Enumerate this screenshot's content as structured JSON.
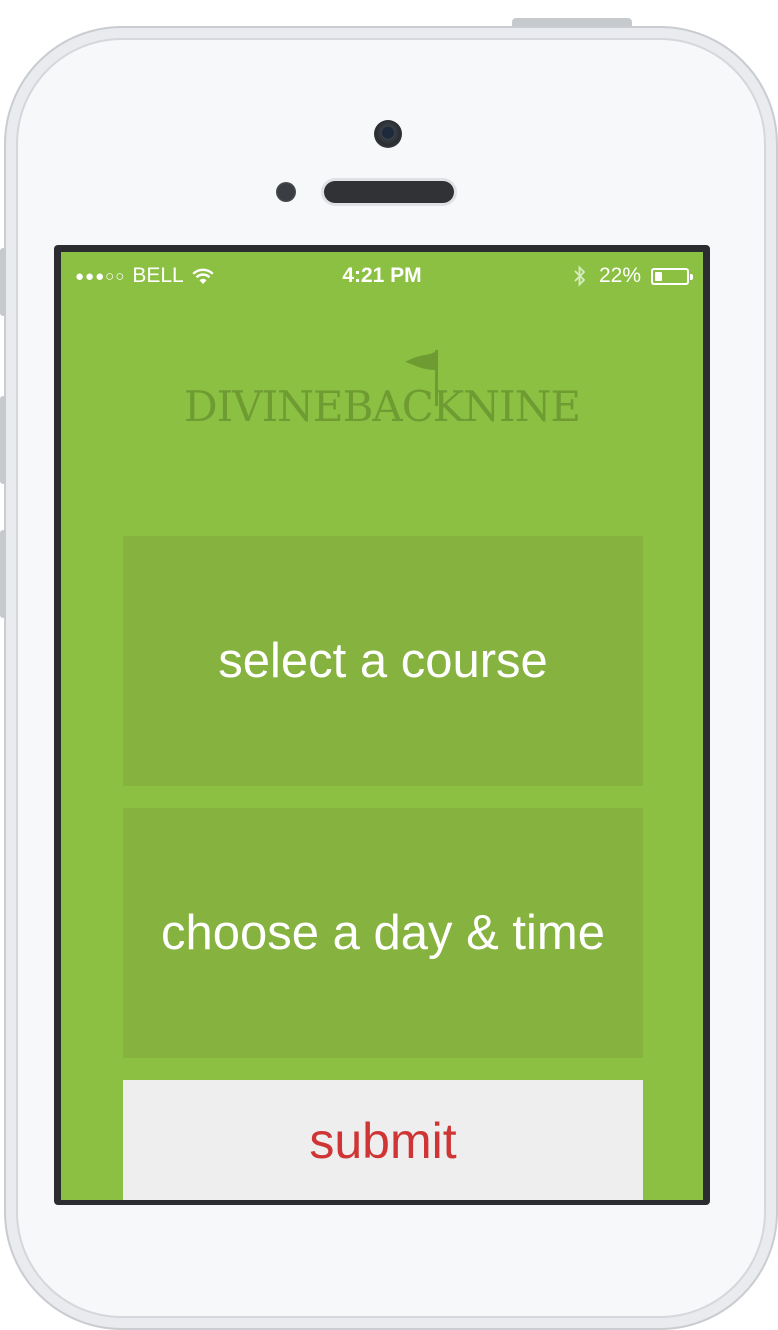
{
  "status_bar": {
    "signal": "●●●○○",
    "carrier": "BELL",
    "time": "4:21 PM",
    "battery_text": "22%",
    "battery_level": 0.22
  },
  "logo": {
    "text": "DIVINEBACKNINE",
    "icon": "golf-flag-icon",
    "color": "#6f9b33"
  },
  "actions": {
    "select_course": "select a course",
    "choose_day_time": "choose a day & time",
    "submit": "submit"
  },
  "colors": {
    "background": "#8bc043",
    "tile": "#86b23f",
    "submit_background": "#eeeeee",
    "submit_text": "#cf3535"
  }
}
